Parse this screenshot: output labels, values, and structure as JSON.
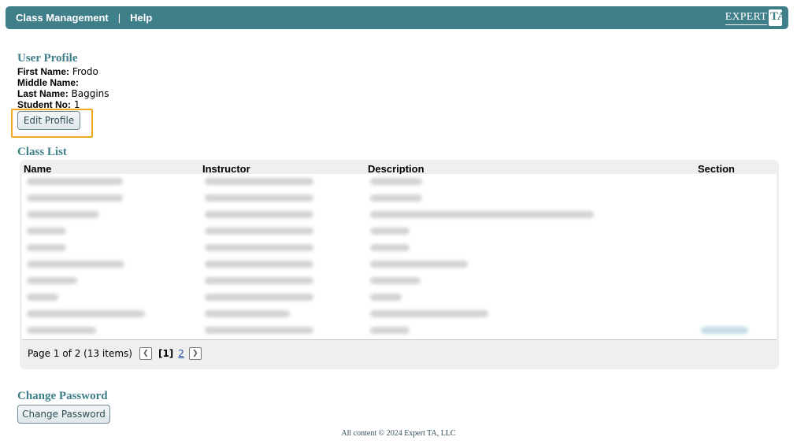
{
  "header": {
    "nav": [
      "Class Management",
      "Help"
    ],
    "separator": "|",
    "logo_text": "EXPERT",
    "logo_mark": "TA"
  },
  "profile": {
    "title": "User Profile",
    "first_name_label": "First Name:",
    "first_name": "Frodo",
    "middle_name_label": "Middle Name:",
    "middle_name": "",
    "last_name_label": "Last Name:",
    "last_name": "Baggins",
    "student_no_label": "Student No:",
    "student_no": "1",
    "edit_button": "Edit Profile"
  },
  "class_list": {
    "title": "Class List",
    "columns": [
      "Name",
      "Instructor",
      "Description",
      "Section"
    ],
    "pager_text": "Page 1 of 2 (13 items)",
    "current_page": "[1]",
    "next_page": "2"
  },
  "password": {
    "title": "Change Password",
    "button": "Change Password"
  },
  "footer": "All content © 2024 Expert TA, LLC"
}
